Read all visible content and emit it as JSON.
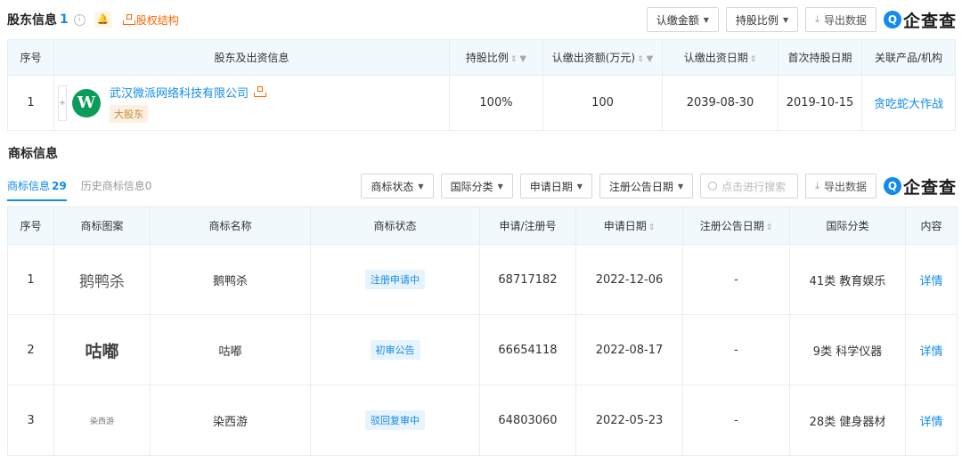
{
  "shareholder": {
    "title": "股东信息",
    "count": "1",
    "structure_label": "股权结构",
    "buttons": {
      "amount": "认缴金额",
      "ratio": "持股比例",
      "export": "导出数据"
    },
    "brand": "企查查",
    "brand_mark": "Q",
    "columns": [
      "序号",
      "股东及出资信息",
      "持股比例",
      "认缴出资额(万元)",
      "认缴出资日期",
      "首次持股日期",
      "关联产品/机构"
    ],
    "rows": [
      {
        "index": "1",
        "name": "武汉微派网络科技有限公司",
        "logo": "W",
        "tag": "大股东",
        "ratio": "100%",
        "amount": "100",
        "subscribe_date": "2039-08-30",
        "first_date": "2019-10-15",
        "product": "贪吃蛇大作战"
      }
    ]
  },
  "trademark": {
    "title": "商标信息",
    "tab_active": "商标信息",
    "tab_active_count": "29",
    "tab_history": "历史商标信息",
    "tab_history_count": "0",
    "filters": {
      "status": "商标状态",
      "intl": "国际分类",
      "apply_date": "申请日期",
      "notice_date": "注册公告日期"
    },
    "search_placeholder": "点击进行搜索",
    "export": "导出数据",
    "brand": "企查查",
    "brand_mark": "Q",
    "columns": [
      "序号",
      "商标图案",
      "商标名称",
      "商标状态",
      "申请/注册号",
      "申请日期",
      "注册公告日期",
      "国际分类",
      "内容"
    ],
    "rows": [
      {
        "index": "1",
        "image_text": "鹅鸭杀",
        "name": "鹅鸭杀",
        "status": "注册申请中",
        "reg_no": "68717182",
        "apply_date": "2022-12-06",
        "notice_date": "-",
        "intl": "41类 教育娱乐",
        "action": "详情"
      },
      {
        "index": "2",
        "image_text": "咕嘟",
        "name": "咕嘟",
        "status": "初审公告",
        "reg_no": "66654118",
        "apply_date": "2022-08-17",
        "notice_date": "-",
        "intl": "9类 科学仪器",
        "action": "详情"
      },
      {
        "index": "3",
        "image_text": "染西游",
        "name": "染西游",
        "status": "驳回复审中",
        "reg_no": "64803060",
        "apply_date": "2022-05-23",
        "notice_date": "-",
        "intl": "28类 健身器材",
        "action": "详情"
      }
    ]
  }
}
